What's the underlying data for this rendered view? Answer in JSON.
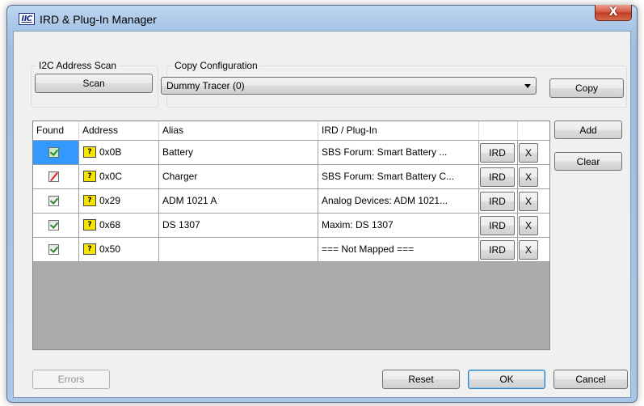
{
  "window": {
    "title": "IRD & Plug-In Manager",
    "app_icon_text": "IIC",
    "close_glyph": "X"
  },
  "scan_group": {
    "label": "I2C Address Scan",
    "button": "Scan"
  },
  "copy_group": {
    "label": "Copy Configuration",
    "selected": "Dummy Tracer (0)",
    "button": "Copy"
  },
  "side_buttons": {
    "add": "Add",
    "clear": "Clear"
  },
  "table": {
    "columns": [
      "Found",
      "Address",
      "Alias",
      "IRD / Plug-In",
      "",
      ""
    ],
    "unknown_icon_text": "?",
    "rows": [
      {
        "found": "checked",
        "address": "0x0B",
        "alias": "Battery",
        "ird": "SBS Forum: Smart Battery ...",
        "ird_button": "IRD",
        "remove_button": "X",
        "selected": true
      },
      {
        "found": "error",
        "address": "0x0C",
        "alias": "Charger",
        "ird": "SBS Forum: Smart Battery C...",
        "ird_button": "IRD",
        "remove_button": "X",
        "selected": false
      },
      {
        "found": "checked",
        "address": "0x29",
        "alias": "ADM 1021 A",
        "ird": "Analog Devices: ADM 1021...",
        "ird_button": "IRD",
        "remove_button": "X",
        "selected": false
      },
      {
        "found": "checked",
        "address": "0x68",
        "alias": "DS 1307",
        "ird": "Maxim: DS 1307",
        "ird_button": "IRD",
        "remove_button": "X",
        "selected": false
      },
      {
        "found": "checked",
        "address": "0x50",
        "alias": "",
        "ird": "=== Not Mapped ===",
        "ird_button": "IRD",
        "remove_button": "X",
        "selected": false
      }
    ]
  },
  "footer": {
    "errors": "Errors",
    "reset": "Reset",
    "ok": "OK",
    "cancel": "Cancel"
  },
  "colors": {
    "selection": "#3399ff",
    "unknown_icon": "#f5e400",
    "check_mark": "#2a8a2a",
    "error_mark": "#e02020",
    "grid_background": "#ababab"
  }
}
